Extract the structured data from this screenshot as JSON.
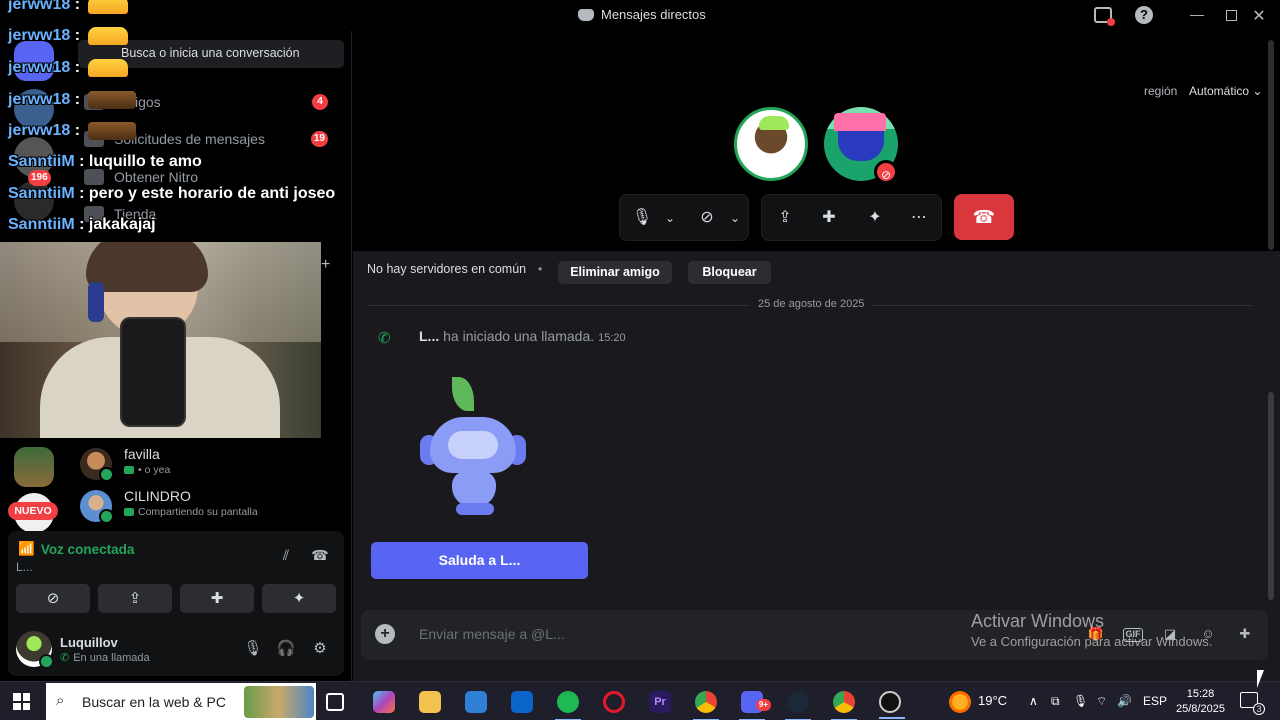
{
  "window": {
    "title": "Mensajes directos",
    "controls": {
      "minimize": "—",
      "maximize": "",
      "close": "✕"
    }
  },
  "sidebar": {
    "search_placeholder": "Busca o inicia una conversación",
    "items": [
      {
        "label": "Amigos",
        "badge": "4"
      },
      {
        "label": "Solicitudes de mensajes",
        "badge": "19"
      },
      {
        "label": "Obtener Nitro",
        "badge": ""
      },
      {
        "label": "Tienda",
        "badge": ""
      }
    ],
    "server_badges": [
      "196"
    ],
    "new_badge": "NUEVO",
    "dms": [
      {
        "name": "favilla",
        "status": "• o yea"
      },
      {
        "name": "CILINDRO",
        "status": "Compartiendo su pantalla"
      }
    ]
  },
  "overlay_chat": [
    {
      "user": "jerww18",
      "sep": " :",
      "msg": ""
    },
    {
      "user": "jerww18",
      "sep": " :",
      "msg": ""
    },
    {
      "user": "jerww18",
      "sep": " :",
      "msg": ""
    },
    {
      "user": "jerww18",
      "sep": " :",
      "msg": ""
    },
    {
      "user": "jerww18",
      "sep": " :",
      "msg": ""
    },
    {
      "user": "SanntiiM",
      "sep": " :",
      "msg": " luquillo te amo"
    },
    {
      "user": "SanntiiM",
      "sep": " :",
      "msg": " pero y este horario de anti joseo"
    },
    {
      "user": "SanntiiM",
      "sep": " :",
      "msg": " jakakajaj"
    }
  ],
  "voice": {
    "status": "Voz conectada",
    "channel": "L..."
  },
  "user_panel": {
    "name": "Luquillov",
    "status": "En una llamada"
  },
  "call": {
    "region_label": "región",
    "region_value": "Automático"
  },
  "profile_bar": {
    "mutual": "No hay servidores en común",
    "remove_friend": "Eliminar amigo",
    "block": "Bloquear"
  },
  "messages": {
    "date": "25 de agosto de 2025",
    "call_user": "L...",
    "call_text": " ha iniciado una llamada.",
    "call_time": "15:20",
    "wave_button": "Saluda a L..."
  },
  "composer": {
    "placeholder": "Enviar mensaje a @L..."
  },
  "watermark": {
    "line1": "Activar Windows",
    "line2": "Ve a Configuración para activar Windows."
  },
  "taskbar": {
    "search_placeholder": "Buscar en la web & PC",
    "weather": "19°C",
    "language": "ESP",
    "time": "15:28",
    "date": "25/8/2025",
    "notifications": "3",
    "discord_badge": "9+"
  },
  "colors": {
    "accent": "#5865f2",
    "online": "#23a55a",
    "danger": "#da373c",
    "badge": "#f23f43",
    "overlay_user": "#6bb3ff"
  }
}
